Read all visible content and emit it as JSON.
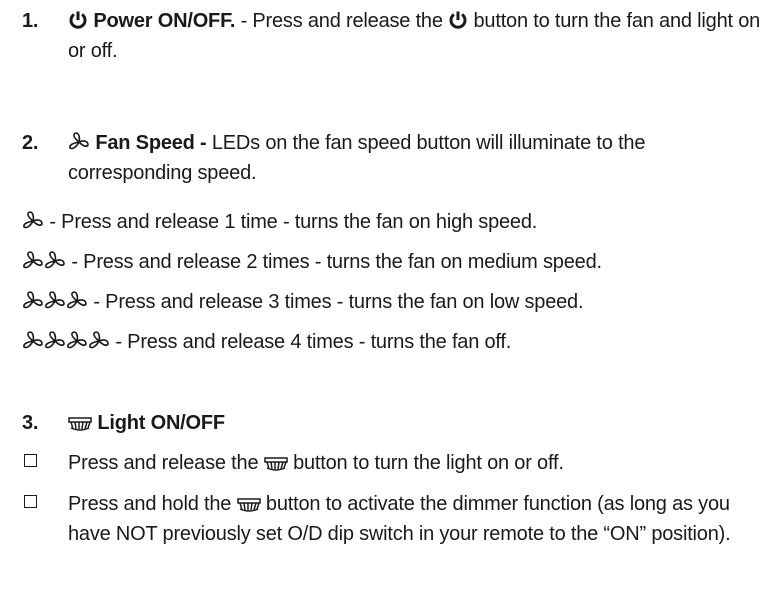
{
  "sections": [
    {
      "number": "1.",
      "icon": "power-icon",
      "title": "Power ON/OFF.",
      "text_a": " - Press and release the ",
      "text_b": " button to turn the fan and light on or off."
    },
    {
      "number": "2.",
      "icon": "fan-icon",
      "title": "Fan Speed -",
      "text": " LEDs on the fan speed button will illuminate to the corresponding speed.",
      "speeds": [
        {
          "fan_count": 1,
          "text": " - Press and release 1 time - turns the fan on high speed."
        },
        {
          "fan_count": 2,
          "text": " - Press and release 2 times - turns the fan on medium speed."
        },
        {
          "fan_count": 3,
          "text": " - Press and release 3 times - turns the fan on low speed."
        },
        {
          "fan_count": 4,
          "text": " - Press and release 4 times - turns the fan off."
        }
      ]
    },
    {
      "number": "3.",
      "icon": "light-icon",
      "title": "Light ON/OFF",
      "bullets": [
        {
          "text_a": "Press and release the ",
          "text_b": " button to turn the light on or off."
        },
        {
          "text_a": "Press and hold the ",
          "text_b": " button to activate the dimmer function (as long as you have NOT previously set O/D dip switch in your remote to the “ON” position)."
        }
      ]
    }
  ]
}
